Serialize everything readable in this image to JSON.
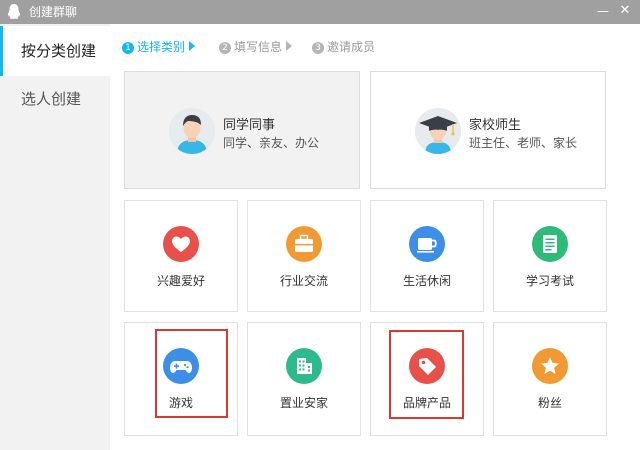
{
  "window": {
    "title": "创建群聊",
    "min_glyph": "—",
    "close_glyph": "✕"
  },
  "sidebar": {
    "items": [
      {
        "label": "按分类创建",
        "active": true
      },
      {
        "label": "选人创建",
        "active": false
      }
    ]
  },
  "steps": [
    {
      "num": "1",
      "label": "选择类别",
      "active": true
    },
    {
      "num": "2",
      "label": "填写信息",
      "active": false
    },
    {
      "num": "3",
      "label": "邀请成员",
      "active": false
    }
  ],
  "big_cards": [
    {
      "title": "同学同事",
      "subtitle": "同学、亲友、办公",
      "icon": "person-avatar-icon"
    },
    {
      "title": "家校师生",
      "subtitle": "班主任、老师、家长",
      "icon": "graduation-cap-icon"
    }
  ],
  "categories": [
    {
      "label": "兴趣爱好",
      "icon": "heart-icon",
      "color": "#e8504a"
    },
    {
      "label": "行业交流",
      "icon": "briefcase-icon",
      "color": "#f19a33"
    },
    {
      "label": "生活休闲",
      "icon": "coffee-cup-icon",
      "color": "#3c8ee7"
    },
    {
      "label": "学习考试",
      "icon": "document-icon",
      "color": "#2dbb78"
    },
    {
      "label": "游戏",
      "icon": "gamepad-icon",
      "color": "#3c8ee7"
    },
    {
      "label": "置业安家",
      "icon": "building-icon",
      "color": "#2dbb8e"
    },
    {
      "label": "品牌产品",
      "icon": "price-tag-icon",
      "color": "#e8504a"
    },
    {
      "label": "粉丝",
      "icon": "star-icon",
      "color": "#f19a33"
    }
  ],
  "colors": {
    "accent": "#12b7f5",
    "highlight_box": "#d63a30",
    "titlebar": "#a0a0a0"
  }
}
